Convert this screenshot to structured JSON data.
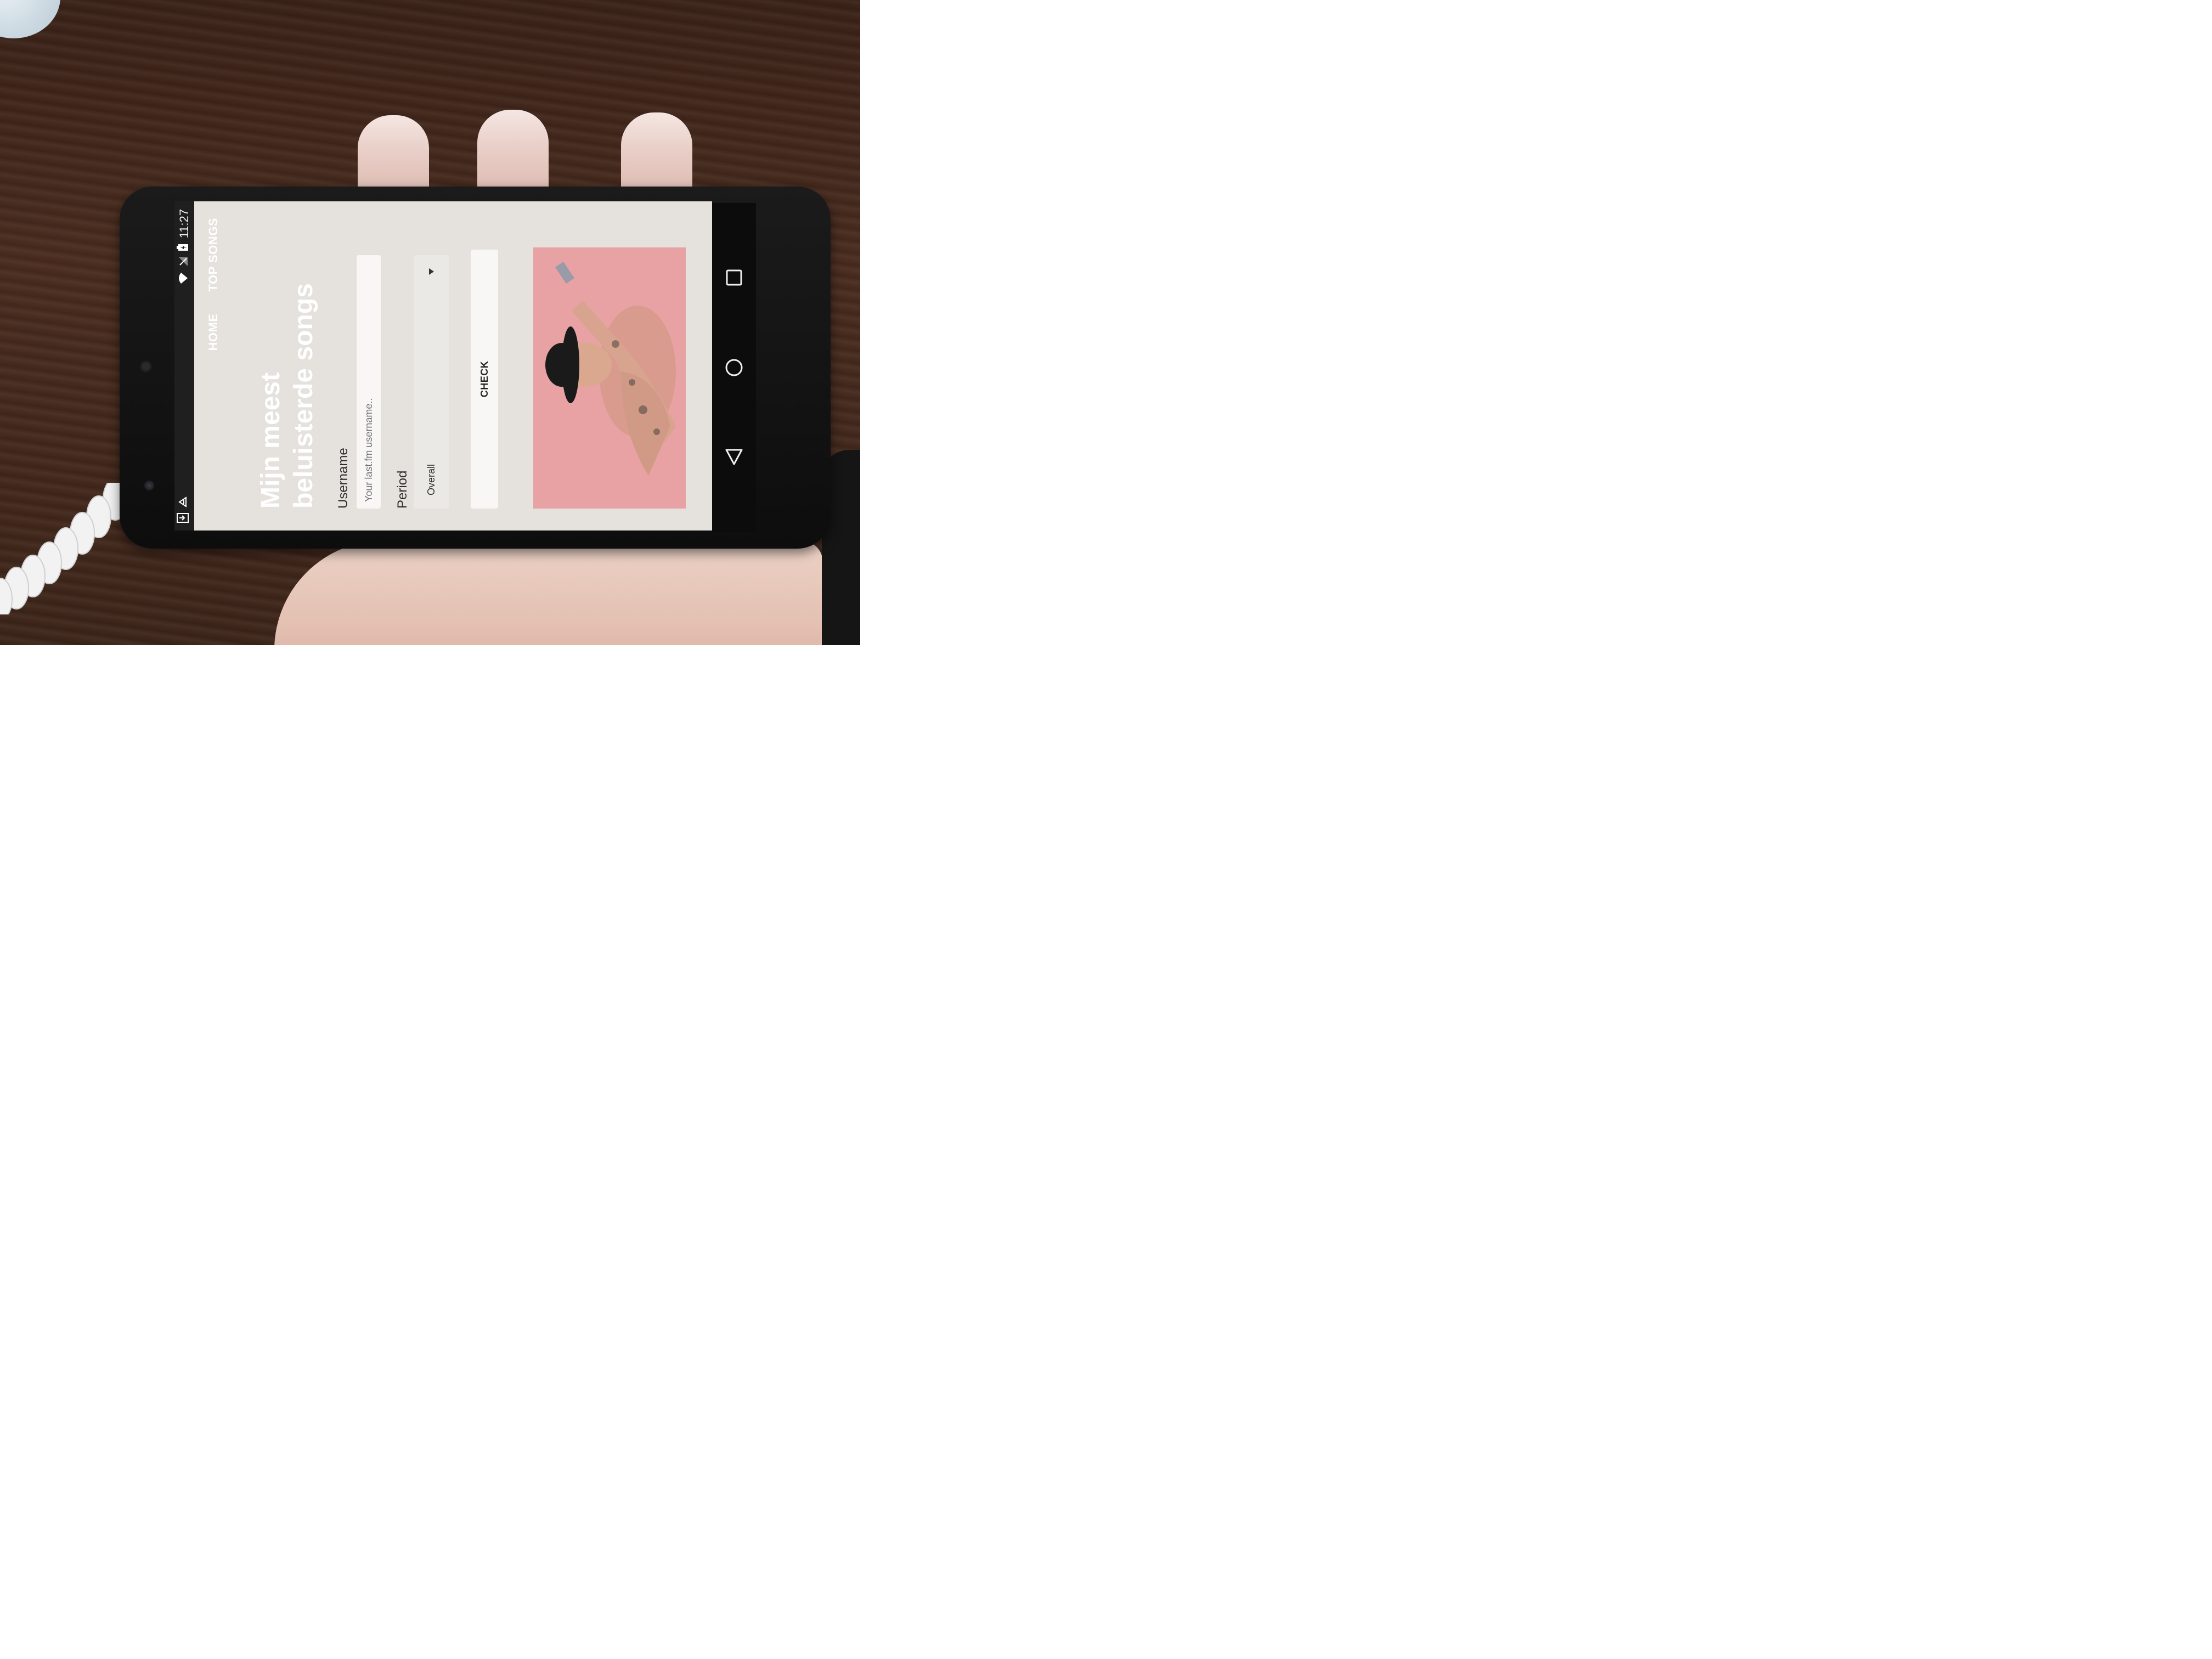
{
  "status_bar": {
    "time": "11:27"
  },
  "nav": {
    "home_label": "HOME",
    "top_songs_label": "TOP SONGS"
  },
  "page": {
    "title_line1": "Mijn meest",
    "title_line2": "beluisterde songs"
  },
  "form": {
    "username_label": "Username",
    "username_placeholder": "Your last.fm username..",
    "period_label": "Period",
    "period_selected": "Overall",
    "check_label": "CHECK"
  },
  "icons": {
    "status": [
      "download-icon",
      "notification-icon",
      "wifi-icon",
      "no-signal-icon",
      "battery-charging-icon"
    ],
    "system_nav": [
      "recent-apps-icon",
      "home-icon",
      "back-icon"
    ]
  },
  "colors": {
    "app_background": "#e5e2dd",
    "hero_background": "#e8a2a4",
    "title_text": "#ffffff"
  }
}
